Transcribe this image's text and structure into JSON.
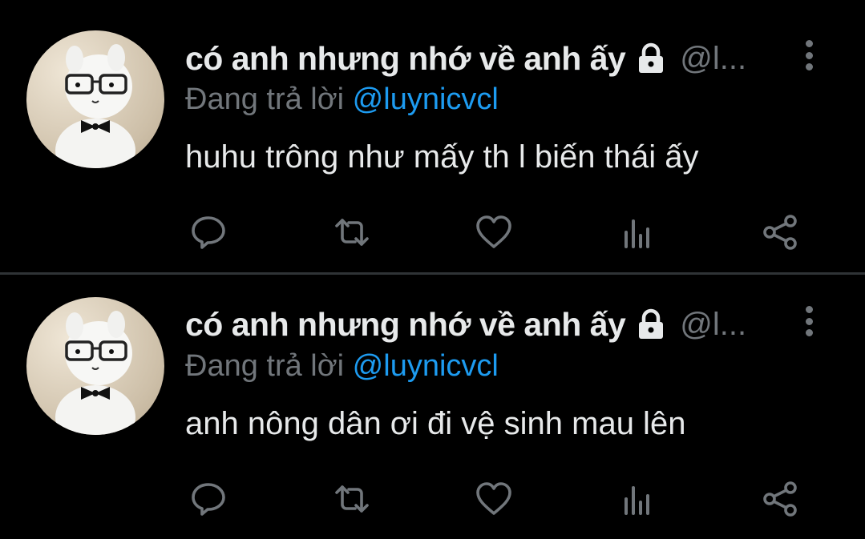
{
  "tweets": [
    {
      "author_name": "có anh nhưng nhớ về anh ấy",
      "handle": "@l...",
      "reply_prefix": "Đang trả lời",
      "reply_to": "@luynicvcl",
      "text": "huhu trông như mấy th l biến thái ấy"
    },
    {
      "author_name": "có anh nhưng nhớ về anh ấy",
      "handle": "@l...",
      "reply_prefix": "Đang trả lời",
      "reply_to": "@luynicvcl",
      "text": "anh nông dân ơi đi vệ sinh mau lên"
    }
  ],
  "icons": {
    "lock": "lock-icon",
    "more": "more-vertical-icon",
    "reply": "reply-icon",
    "retweet": "retweet-icon",
    "like": "heart-icon",
    "views": "views-icon",
    "share": "share-icon"
  },
  "colors": {
    "background": "#000000",
    "text_primary": "#e7e9ea",
    "text_secondary": "#71767b",
    "accent": "#1d9bf0",
    "divider": "#2f3336"
  }
}
